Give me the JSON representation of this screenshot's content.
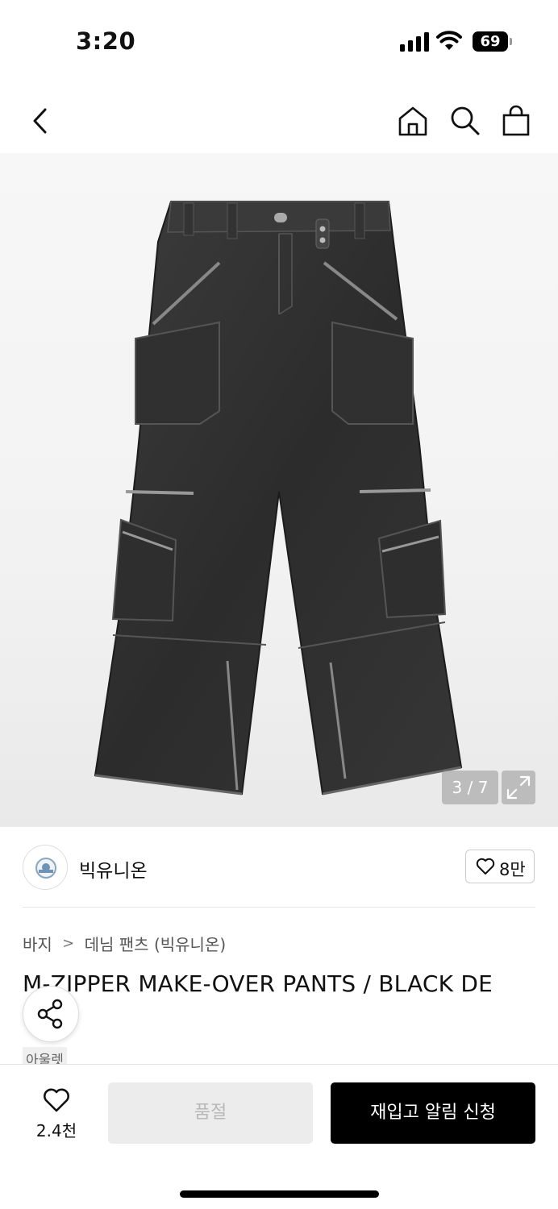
{
  "status": {
    "time": "3:20",
    "battery": "69"
  },
  "gallery": {
    "counter": "3 / 7"
  },
  "brand": {
    "name": "빅유니온",
    "likes": "8만"
  },
  "breadcrumb": {
    "category": "바지",
    "subcategory": "데님 팬츠 (빅유니온)"
  },
  "product": {
    "title": "M-ZIPPER MAKE-OVER PANTS / BLACK DE",
    "tag": "아울렛"
  },
  "bottom": {
    "wish_count": "2.4천",
    "soldout_label": "품절",
    "restock_label": "재입고 알림 신청"
  },
  "icons": {
    "back": "chevron-left-icon",
    "home": "home-icon",
    "search": "search-icon",
    "bag": "shopping-bag-icon",
    "expand": "expand-icon",
    "share": "share-icon",
    "heart": "heart-icon"
  }
}
